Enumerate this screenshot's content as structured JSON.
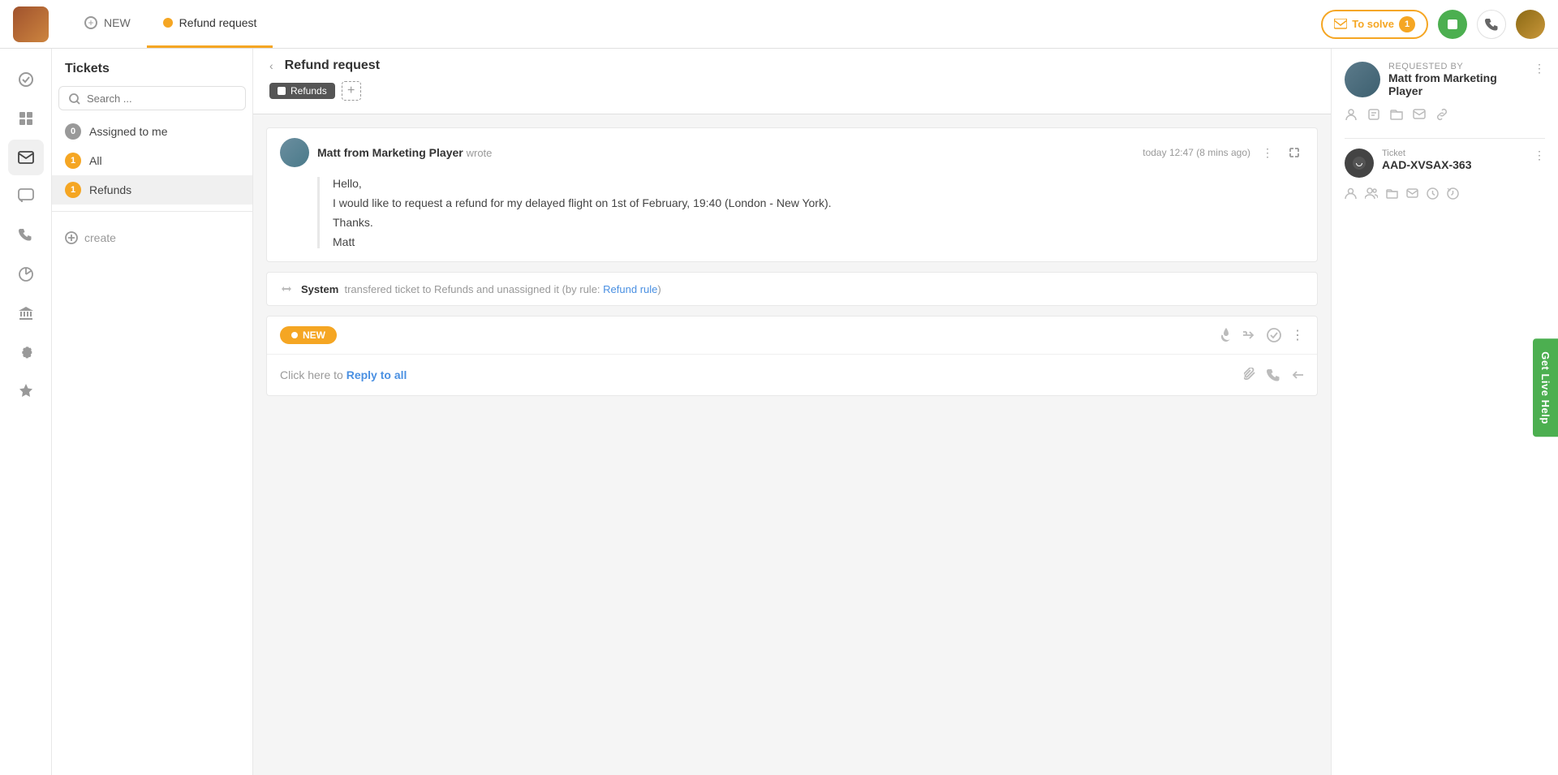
{
  "topbar": {
    "new_tab_label": "NEW",
    "active_tab_label": "Refund request",
    "to_solve_label": "To solve",
    "to_solve_count": "1"
  },
  "sidebar": {
    "title": "Tickets",
    "search_placeholder": "Search ...",
    "items": [
      {
        "label": "Assigned to me",
        "count": "0",
        "count_type": "gray"
      },
      {
        "label": "All",
        "count": "1",
        "count_type": "orange"
      },
      {
        "label": "Refunds",
        "count": "1",
        "count_type": "orange",
        "active": true
      }
    ],
    "create_label": "create"
  },
  "ticket": {
    "title": "Refund request",
    "tag": "Refunds",
    "collapse_label": "‹"
  },
  "message": {
    "sender": "Matt from Marketing Player",
    "wrote": "wrote",
    "time": "today 12:47 (8 mins ago)",
    "greeting": "Hello,",
    "body1": "I would like to request a refund for my delayed flight on 1st of February, 19:40 (London - New York).",
    "body2": "Thanks.",
    "body3": "Matt"
  },
  "system": {
    "actor": "System",
    "text": "transfered ticket to Refunds and unassigned it (by rule: Refund rule)"
  },
  "new_reply": {
    "badge": "NEW",
    "reply_prompt": "Click here to",
    "reply_action": "Reply to all"
  },
  "right_panel": {
    "requested_by_label": "Requested by",
    "requester_name": "Matt from Marketing Player",
    "ticket_label": "Ticket",
    "ticket_id": "AAD-XVSAX-363"
  },
  "live_help": {
    "label": "Get Live Help"
  },
  "nav_icons": [
    {
      "name": "check-icon",
      "symbol": "✓",
      "active": false
    },
    {
      "name": "grid-icon",
      "symbol": "⊞",
      "active": false
    },
    {
      "name": "mail-icon",
      "symbol": "✉",
      "active": true
    },
    {
      "name": "chat-icon",
      "symbol": "💬",
      "active": false
    },
    {
      "name": "phone-icon",
      "symbol": "📞",
      "active": false
    },
    {
      "name": "analytics-icon",
      "symbol": "◯",
      "active": false
    },
    {
      "name": "bank-icon",
      "symbol": "🏛",
      "active": false
    },
    {
      "name": "settings-icon",
      "symbol": "⚙",
      "active": false
    },
    {
      "name": "star-icon",
      "symbol": "★",
      "active": false
    }
  ]
}
